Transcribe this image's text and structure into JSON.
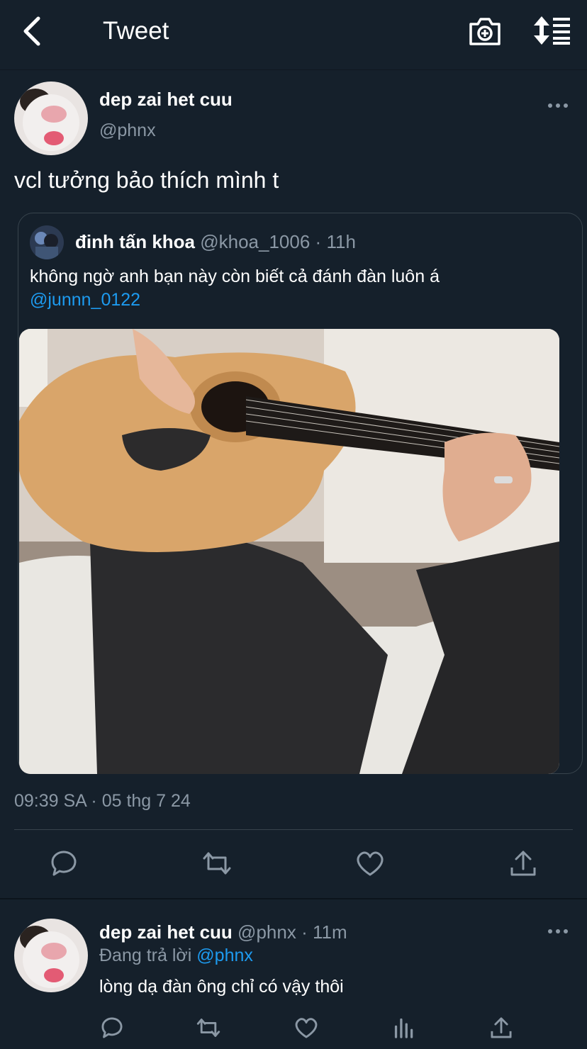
{
  "header": {
    "title": "Tweet",
    "icons": [
      "back-icon",
      "camera-icon",
      "sort-icon"
    ]
  },
  "tweet": {
    "display_name": "dep zai het cuu",
    "handle": "@phnx",
    "text": "vcl tưởng bảo thích mình t",
    "timestamp": "09:39 SA · 05 thg 7 24",
    "quote": {
      "display_name": "đinh tấn khoa",
      "handle": "@khoa_1006",
      "separator": "·",
      "time": "11h",
      "text": "không ngờ anh bạn này còn biết cả đánh đàn luôn á",
      "mention": "@junnn_0122"
    },
    "actions": [
      "reply-icon",
      "retweet-icon",
      "like-icon",
      "share-icon"
    ]
  },
  "reply": {
    "display_name": "dep zai het cuu",
    "handle": "@phnx",
    "separator": "·",
    "time": "11m",
    "replying_label": "Đang trả lời",
    "replying_handle": "@phnx",
    "text": "lòng dạ đàn ông chỉ có vậy thôi",
    "actions": [
      "reply-icon",
      "retweet-icon",
      "like-icon",
      "analytics-icon",
      "share-icon"
    ]
  },
  "colors": {
    "background": "#15202b",
    "text": "#ffffff",
    "muted": "#8b98a5",
    "accent": "#1d9bf0",
    "border": "#38444d"
  }
}
